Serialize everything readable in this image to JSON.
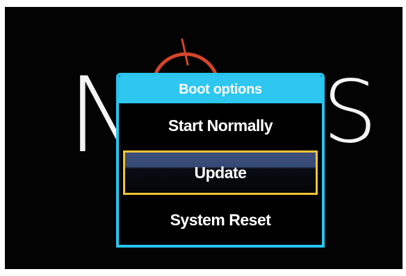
{
  "background_logo": {
    "left_letter": "N",
    "right_letter": "S",
    "emblem_color": "#d4452a"
  },
  "boot_menu": {
    "title": "Boot options",
    "items": [
      {
        "label": "Start Normally",
        "selected": false
      },
      {
        "label": "Update",
        "selected": true
      },
      {
        "label": "System Reset",
        "selected": false
      }
    ]
  },
  "colors": {
    "accent": "#2ec7f0",
    "selection_border": "#f0c437",
    "background": "#030303"
  }
}
